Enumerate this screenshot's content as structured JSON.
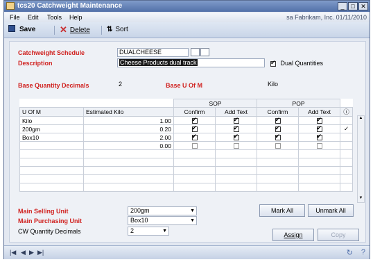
{
  "window": {
    "title": "tcs20 Catchweight Maintenance",
    "controls": {
      "minimize": "_",
      "maximize": "□",
      "close": "✕"
    }
  },
  "menu": {
    "items": [
      "File",
      "Edit",
      "Tools",
      "Help"
    ],
    "company_info": "sa  Fabrikam, Inc.  01/11/2010"
  },
  "toolbar": {
    "save": "Save",
    "delete": "Delete",
    "sort": "Sort"
  },
  "form": {
    "catchweight_schedule_label": "Catchweight Schedule",
    "catchweight_schedule_value": "DUALCHEESE",
    "description_label": "Description",
    "description_value": "Cheese Products dual track",
    "dual_quantities_label": "Dual Quantities",
    "dual_quantities_checked": true,
    "base_qty_decimals_label": "Base Quantity Decimals",
    "base_qty_decimals_value": "2",
    "base_uom_label": "Base U Of M",
    "base_uom_value": "Kilo"
  },
  "grid": {
    "group_headers": {
      "sop": "SOP",
      "pop": "POP"
    },
    "columns": [
      "U Of M",
      "Estimated Kilo",
      "Confirm",
      "Add Text",
      "Confirm",
      "Add Text",
      "ⓘ"
    ],
    "rows": [
      {
        "uom": "Kilo",
        "est": "1.00",
        "sop_confirm": true,
        "sop_addtext": true,
        "pop_confirm": true,
        "pop_addtext": true,
        "mark": ""
      },
      {
        "uom": "200gm",
        "est": "0.20",
        "sop_confirm": true,
        "sop_addtext": true,
        "pop_confirm": true,
        "pop_addtext": true,
        "mark": "✓"
      },
      {
        "uom": "Box10",
        "est": "2.00",
        "sop_confirm": true,
        "sop_addtext": true,
        "pop_confirm": true,
        "pop_addtext": true,
        "mark": ""
      },
      {
        "uom": "",
        "est": "0.00",
        "sop_confirm": false,
        "sop_addtext": false,
        "pop_confirm": false,
        "pop_addtext": false,
        "mark": ""
      }
    ]
  },
  "bottom": {
    "main_selling_label": "Main Selling Unit",
    "main_selling_value": "200gm",
    "main_purchasing_label": "Main Purchasing Unit",
    "main_purchasing_value": "Box10",
    "cw_qty_decimals_label": "CW Quantity Decimals",
    "cw_qty_decimals_value": "2",
    "mark_all": "Mark All",
    "unmark_all": "Unmark All",
    "assign": "Assign",
    "copy": "Copy"
  },
  "status": {
    "nav": [
      "|◀",
      "◀",
      "▶",
      "▶|"
    ]
  }
}
